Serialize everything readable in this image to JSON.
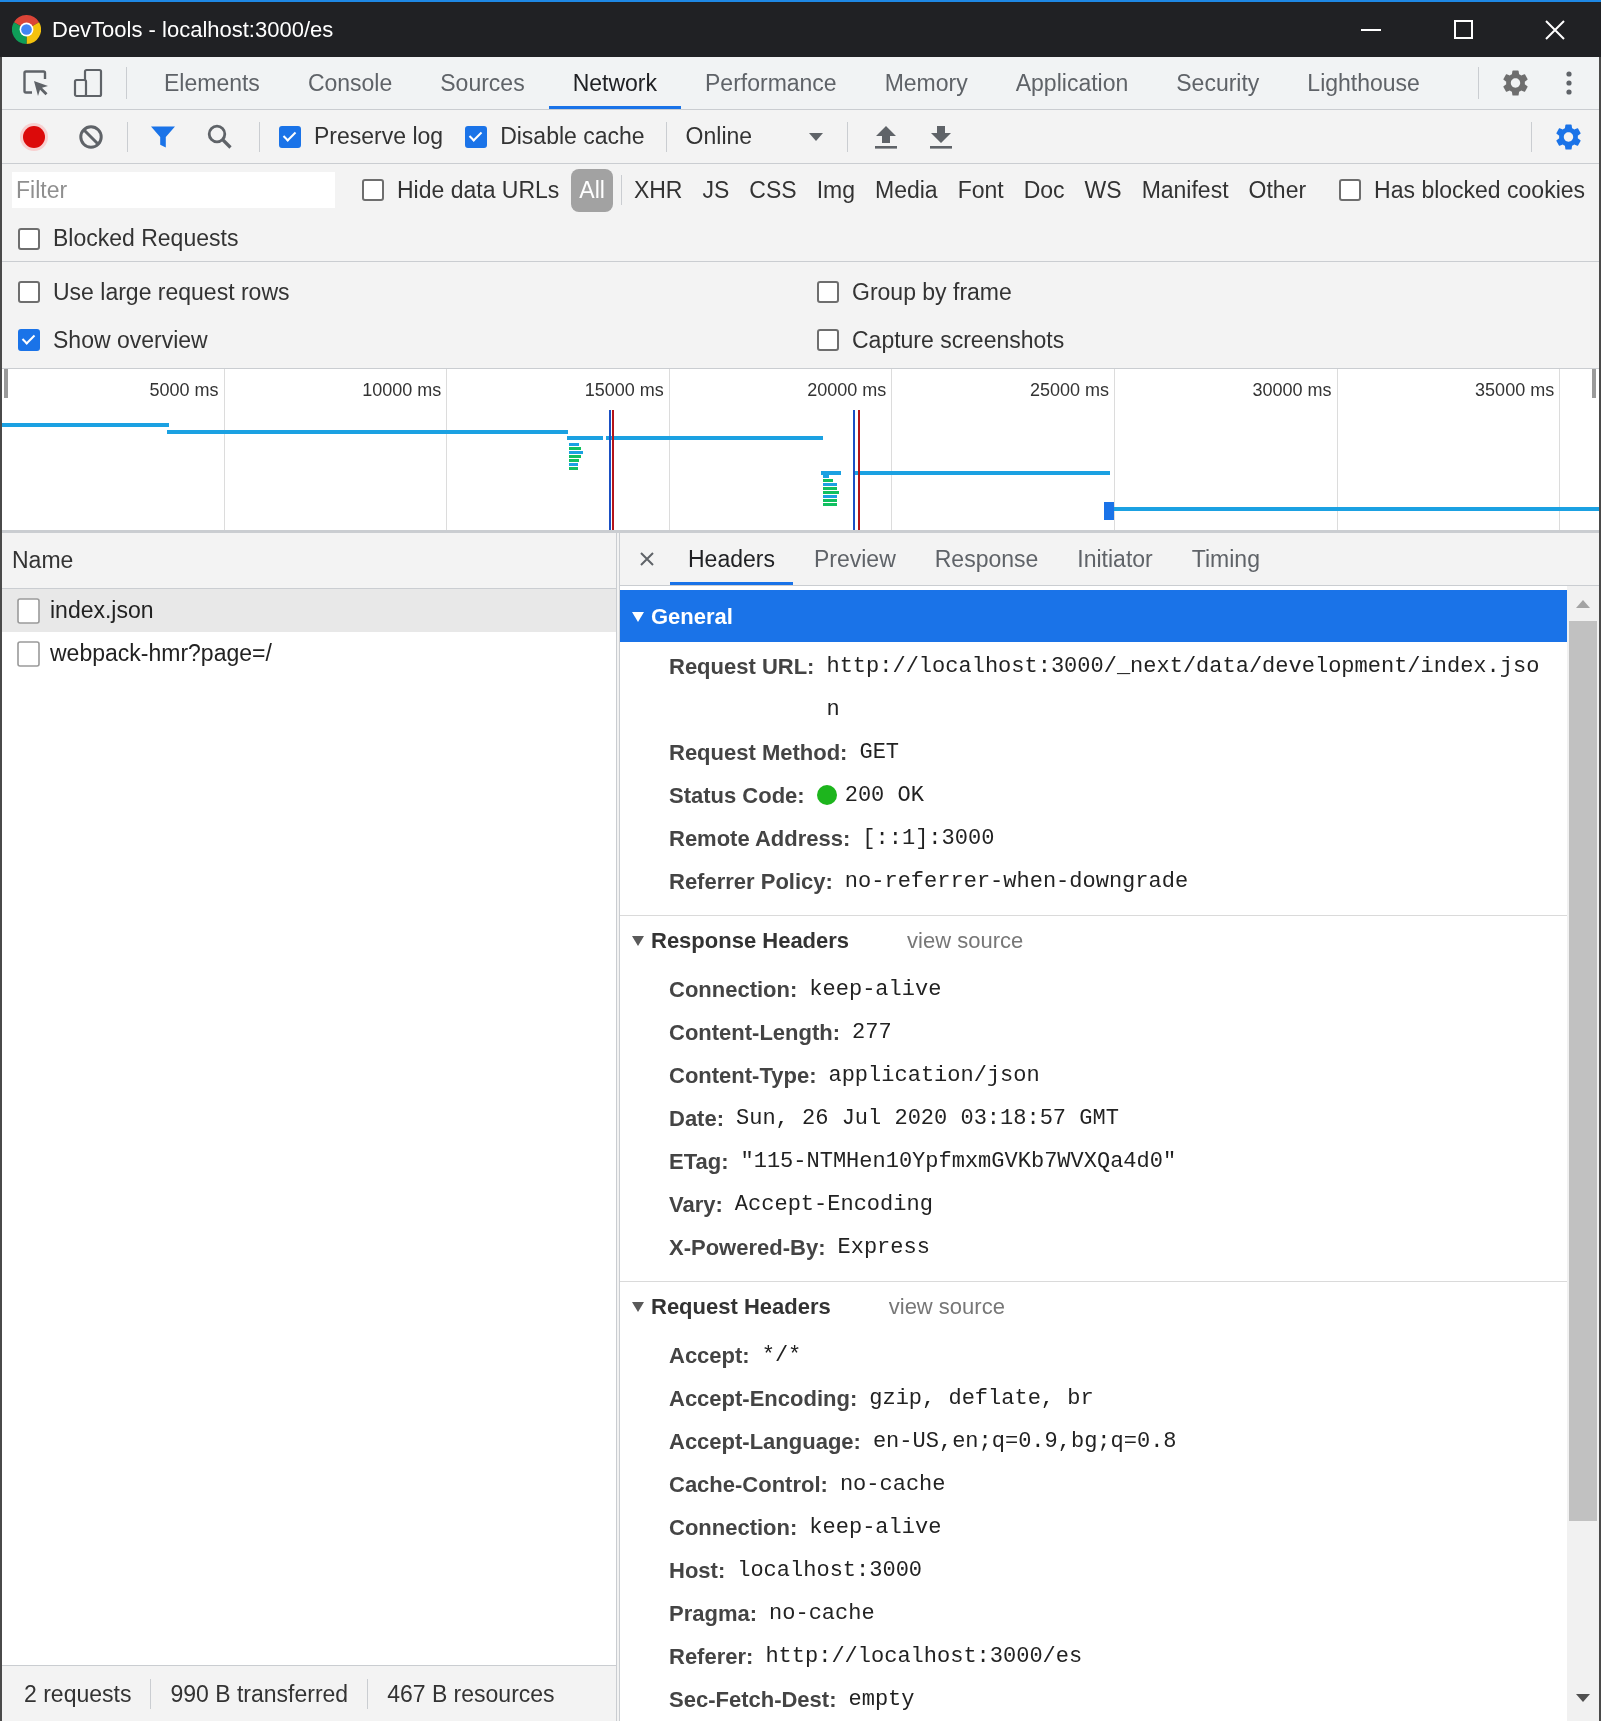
{
  "window": {
    "title": "DevTools - localhost:3000/es"
  },
  "panel_tabs": [
    {
      "label": "Elements",
      "selected": false
    },
    {
      "label": "Console",
      "selected": false
    },
    {
      "label": "Sources",
      "selected": false
    },
    {
      "label": "Network",
      "selected": true
    },
    {
      "label": "Performance",
      "selected": false
    },
    {
      "label": "Memory",
      "selected": false
    },
    {
      "label": "Application",
      "selected": false
    },
    {
      "label": "Security",
      "selected": false
    },
    {
      "label": "Lighthouse",
      "selected": false
    }
  ],
  "toolbar": {
    "recording": true,
    "filter_open": true,
    "settings_open": true,
    "preserve_log": {
      "label": "Preserve log",
      "checked": true
    },
    "disable_cache": {
      "label": "Disable cache",
      "checked": true
    },
    "throttling": "Online"
  },
  "filter_bar": {
    "placeholder": "Filter",
    "hide_data_urls": {
      "label": "Hide data URLs",
      "checked": false
    },
    "types": [
      {
        "label": "All",
        "selected": true
      },
      {
        "label": "XHR",
        "selected": false
      },
      {
        "label": "JS",
        "selected": false
      },
      {
        "label": "CSS",
        "selected": false
      },
      {
        "label": "Img",
        "selected": false
      },
      {
        "label": "Media",
        "selected": false
      },
      {
        "label": "Font",
        "selected": false
      },
      {
        "label": "Doc",
        "selected": false
      },
      {
        "label": "WS",
        "selected": false
      },
      {
        "label": "Manifest",
        "selected": false
      },
      {
        "label": "Other",
        "selected": false
      }
    ],
    "has_blocked_cookies": {
      "label": "Has blocked cookies",
      "checked": false
    },
    "blocked_requests": {
      "label": "Blocked Requests",
      "checked": false
    }
  },
  "settings": [
    {
      "label": "Use large request rows",
      "checked": false
    },
    {
      "label": "Group by frame",
      "checked": false
    },
    {
      "label": "Show overview",
      "checked": true
    },
    {
      "label": "Capture screenshots",
      "checked": false
    }
  ],
  "overview": {
    "ticks": [
      "5000 ms",
      "10000 ms",
      "15000 ms",
      "20000 ms",
      "25000 ms",
      "30000 ms",
      "35000 ms"
    ]
  },
  "requests": {
    "column": "Name",
    "rows": [
      {
        "name": "index.json",
        "selected": true
      },
      {
        "name": "webpack-hmr?page=/",
        "selected": false
      }
    ]
  },
  "status_bar": [
    "2 requests",
    "990 B transferred",
    "467 B resources"
  ],
  "details": {
    "tabs": [
      {
        "label": "Headers",
        "selected": true
      },
      {
        "label": "Preview",
        "selected": false
      },
      {
        "label": "Response",
        "selected": false
      },
      {
        "label": "Initiator",
        "selected": false
      },
      {
        "label": "Timing",
        "selected": false
      }
    ],
    "sections": [
      {
        "title": "General",
        "expanded": true,
        "selected": true,
        "headers": [
          {
            "name": "Request URL:",
            "value": "http://localhost:3000/_next/data/development/index.json"
          },
          {
            "name": "Request Method:",
            "value": "GET"
          },
          {
            "name": "Status Code:",
            "value": "200 OK",
            "color": "#1db51d"
          },
          {
            "name": "Remote Address:",
            "value": "[::1]:3000"
          },
          {
            "name": "Referrer Policy:",
            "value": "no-referrer-when-downgrade"
          }
        ]
      },
      {
        "title": "Response Headers",
        "expanded": true,
        "selected": false,
        "view_source": "view source",
        "headers": [
          {
            "name": "Connection:",
            "value": "keep-alive"
          },
          {
            "name": "Content-Length:",
            "value": "277"
          },
          {
            "name": "Content-Type:",
            "value": "application/json"
          },
          {
            "name": "Date:",
            "value": "Sun, 26 Jul 2020 03:18:57 GMT"
          },
          {
            "name": "ETag:",
            "value": "\"115-NTMHen10YpfmxmGVKb7WVXQa4d0\""
          },
          {
            "name": "Vary:",
            "value": "Accept-Encoding"
          },
          {
            "name": "X-Powered-By:",
            "value": "Express"
          }
        ]
      },
      {
        "title": "Request Headers",
        "expanded": true,
        "selected": false,
        "view_source": "view source",
        "headers": [
          {
            "name": "Accept:",
            "value": "*/*"
          },
          {
            "name": "Accept-Encoding:",
            "value": "gzip, deflate, br"
          },
          {
            "name": "Accept-Language:",
            "value": "en-US,en;q=0.9,bg;q=0.8"
          },
          {
            "name": "Cache-Control:",
            "value": "no-cache"
          },
          {
            "name": "Connection:",
            "value": "keep-alive"
          },
          {
            "name": "Host:",
            "value": "localhost:3000"
          },
          {
            "name": "Pragma:",
            "value": "no-cache"
          },
          {
            "name": "Referer:",
            "value": "http://localhost:3000/es"
          },
          {
            "name": "Sec-Fetch-Dest:",
            "value": "empty"
          }
        ]
      }
    ]
  }
}
